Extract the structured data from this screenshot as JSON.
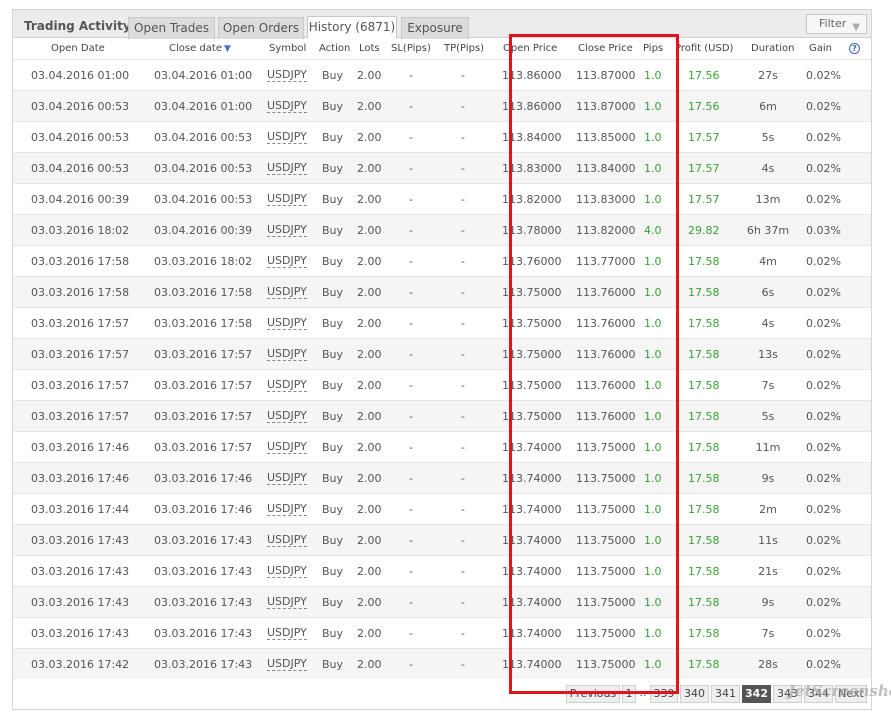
{
  "panel": {
    "title": "Trading Activity"
  },
  "tabs": [
    {
      "label": "Open Trades",
      "active": false
    },
    {
      "label": "Open Orders",
      "active": false
    },
    {
      "label": "History (6871)",
      "active": true
    },
    {
      "label": "Exposure",
      "active": false
    }
  ],
  "filter": {
    "label": "Filter",
    "caret": "▼"
  },
  "columns": {
    "open_date": "Open Date",
    "close_date": "Close date",
    "sort_indicator": "▼",
    "symbol": "Symbol",
    "action": "Action",
    "lots": "Lots",
    "sl": "SL(Pips)",
    "tp": "TP(Pips)",
    "open_price": "Open Price",
    "close_price": "Close Price",
    "pips": "Pips",
    "profit": "Profit (USD)",
    "duration": "Duration",
    "gain": "Gain",
    "help": "?"
  },
  "rows": [
    {
      "open_date": "03.04.2016 01:00",
      "close_date": "03.04.2016 01:00",
      "symbol": "USDJPY",
      "action": "Buy",
      "lots": "2.00",
      "sl": "-",
      "tp": "-",
      "open_price": "113.86000",
      "close_price": "113.87000",
      "pips": "1.0",
      "profit": "17.56",
      "duration": "27s",
      "gain": "0.02%"
    },
    {
      "open_date": "03.04.2016 00:53",
      "close_date": "03.04.2016 01:00",
      "symbol": "USDJPY",
      "action": "Buy",
      "lots": "2.00",
      "sl": "-",
      "tp": "-",
      "open_price": "113.86000",
      "close_price": "113.87000",
      "pips": "1.0",
      "profit": "17.56",
      "duration": "6m",
      "gain": "0.02%"
    },
    {
      "open_date": "03.04.2016 00:53",
      "close_date": "03.04.2016 00:53",
      "symbol": "USDJPY",
      "action": "Buy",
      "lots": "2.00",
      "sl": "-",
      "tp": "-",
      "open_price": "113.84000",
      "close_price": "113.85000",
      "pips": "1.0",
      "profit": "17.57",
      "duration": "5s",
      "gain": "0.02%"
    },
    {
      "open_date": "03.04.2016 00:53",
      "close_date": "03.04.2016 00:53",
      "symbol": "USDJPY",
      "action": "Buy",
      "lots": "2.00",
      "sl": "-",
      "tp": "-",
      "open_price": "113.83000",
      "close_price": "113.84000",
      "pips": "1.0",
      "profit": "17.57",
      "duration": "4s",
      "gain": "0.02%"
    },
    {
      "open_date": "03.04.2016 00:39",
      "close_date": "03.04.2016 00:53",
      "symbol": "USDJPY",
      "action": "Buy",
      "lots": "2.00",
      "sl": "-",
      "tp": "-",
      "open_price": "113.82000",
      "close_price": "113.83000",
      "pips": "1.0",
      "profit": "17.57",
      "duration": "13m",
      "gain": "0.02%"
    },
    {
      "open_date": "03.03.2016 18:02",
      "close_date": "03.04.2016 00:39",
      "symbol": "USDJPY",
      "action": "Buy",
      "lots": "2.00",
      "sl": "-",
      "tp": "-",
      "open_price": "113.78000",
      "close_price": "113.82000",
      "pips": "4.0",
      "profit": "29.82",
      "duration": "6h 37m",
      "gain": "0.03%"
    },
    {
      "open_date": "03.03.2016 17:58",
      "close_date": "03.03.2016 18:02",
      "symbol": "USDJPY",
      "action": "Buy",
      "lots": "2.00",
      "sl": "-",
      "tp": "-",
      "open_price": "113.76000",
      "close_price": "113.77000",
      "pips": "1.0",
      "profit": "17.58",
      "duration": "4m",
      "gain": "0.02%"
    },
    {
      "open_date": "03.03.2016 17:58",
      "close_date": "03.03.2016 17:58",
      "symbol": "USDJPY",
      "action": "Buy",
      "lots": "2.00",
      "sl": "-",
      "tp": "-",
      "open_price": "113.75000",
      "close_price": "113.76000",
      "pips": "1.0",
      "profit": "17.58",
      "duration": "6s",
      "gain": "0.02%"
    },
    {
      "open_date": "03.03.2016 17:57",
      "close_date": "03.03.2016 17:58",
      "symbol": "USDJPY",
      "action": "Buy",
      "lots": "2.00",
      "sl": "-",
      "tp": "-",
      "open_price": "113.75000",
      "close_price": "113.76000",
      "pips": "1.0",
      "profit": "17.58",
      "duration": "4s",
      "gain": "0.02%"
    },
    {
      "open_date": "03.03.2016 17:57",
      "close_date": "03.03.2016 17:57",
      "symbol": "USDJPY",
      "action": "Buy",
      "lots": "2.00",
      "sl": "-",
      "tp": "-",
      "open_price": "113.75000",
      "close_price": "113.76000",
      "pips": "1.0",
      "profit": "17.58",
      "duration": "13s",
      "gain": "0.02%"
    },
    {
      "open_date": "03.03.2016 17:57",
      "close_date": "03.03.2016 17:57",
      "symbol": "USDJPY",
      "action": "Buy",
      "lots": "2.00",
      "sl": "-",
      "tp": "-",
      "open_price": "113.75000",
      "close_price": "113.76000",
      "pips": "1.0",
      "profit": "17.58",
      "duration": "7s",
      "gain": "0.02%"
    },
    {
      "open_date": "03.03.2016 17:57",
      "close_date": "03.03.2016 17:57",
      "symbol": "USDJPY",
      "action": "Buy",
      "lots": "2.00",
      "sl": "-",
      "tp": "-",
      "open_price": "113.75000",
      "close_price": "113.76000",
      "pips": "1.0",
      "profit": "17.58",
      "duration": "5s",
      "gain": "0.02%"
    },
    {
      "open_date": "03.03.2016 17:46",
      "close_date": "03.03.2016 17:57",
      "symbol": "USDJPY",
      "action": "Buy",
      "lots": "2.00",
      "sl": "-",
      "tp": "-",
      "open_price": "113.74000",
      "close_price": "113.75000",
      "pips": "1.0",
      "profit": "17.58",
      "duration": "11m",
      "gain": "0.02%"
    },
    {
      "open_date": "03.03.2016 17:46",
      "close_date": "03.03.2016 17:46",
      "symbol": "USDJPY",
      "action": "Buy",
      "lots": "2.00",
      "sl": "-",
      "tp": "-",
      "open_price": "113.74000",
      "close_price": "113.75000",
      "pips": "1.0",
      "profit": "17.58",
      "duration": "9s",
      "gain": "0.02%"
    },
    {
      "open_date": "03.03.2016 17:44",
      "close_date": "03.03.2016 17:46",
      "symbol": "USDJPY",
      "action": "Buy",
      "lots": "2.00",
      "sl": "-",
      "tp": "-",
      "open_price": "113.74000",
      "close_price": "113.75000",
      "pips": "1.0",
      "profit": "17.58",
      "duration": "2m",
      "gain": "0.02%"
    },
    {
      "open_date": "03.03.2016 17:43",
      "close_date": "03.03.2016 17:43",
      "symbol": "USDJPY",
      "action": "Buy",
      "lots": "2.00",
      "sl": "-",
      "tp": "-",
      "open_price": "113.74000",
      "close_price": "113.75000",
      "pips": "1.0",
      "profit": "17.58",
      "duration": "11s",
      "gain": "0.02%"
    },
    {
      "open_date": "03.03.2016 17:43",
      "close_date": "03.03.2016 17:43",
      "symbol": "USDJPY",
      "action": "Buy",
      "lots": "2.00",
      "sl": "-",
      "tp": "-",
      "open_price": "113.74000",
      "close_price": "113.75000",
      "pips": "1.0",
      "profit": "17.58",
      "duration": "21s",
      "gain": "0.02%"
    },
    {
      "open_date": "03.03.2016 17:43",
      "close_date": "03.03.2016 17:43",
      "symbol": "USDJPY",
      "action": "Buy",
      "lots": "2.00",
      "sl": "-",
      "tp": "-",
      "open_price": "113.74000",
      "close_price": "113.75000",
      "pips": "1.0",
      "profit": "17.58",
      "duration": "9s",
      "gain": "0.02%"
    },
    {
      "open_date": "03.03.2016 17:43",
      "close_date": "03.03.2016 17:43",
      "symbol": "USDJPY",
      "action": "Buy",
      "lots": "2.00",
      "sl": "-",
      "tp": "-",
      "open_price": "113.74000",
      "close_price": "113.75000",
      "pips": "1.0",
      "profit": "17.58",
      "duration": "7s",
      "gain": "0.02%"
    },
    {
      "open_date": "03.03.2016 17:42",
      "close_date": "03.03.2016 17:43",
      "symbol": "USDJPY",
      "action": "Buy",
      "lots": "2.00",
      "sl": "-",
      "tp": "-",
      "open_price": "113.74000",
      "close_price": "113.75000",
      "pips": "1.0",
      "profit": "17.58",
      "duration": "28s",
      "gain": "0.02%"
    }
  ],
  "pagination": {
    "previous": "Previous",
    "first": "1",
    "ellipsis": "..",
    "pages": [
      "339",
      "340",
      "341",
      "342",
      "343",
      "344"
    ],
    "current": "342",
    "next": "Next"
  },
  "watermark": "JetScreenshot",
  "colors": {
    "profit_green": "#3aa036",
    "highlight_red": "#e2131a",
    "active_page": "#555555"
  }
}
